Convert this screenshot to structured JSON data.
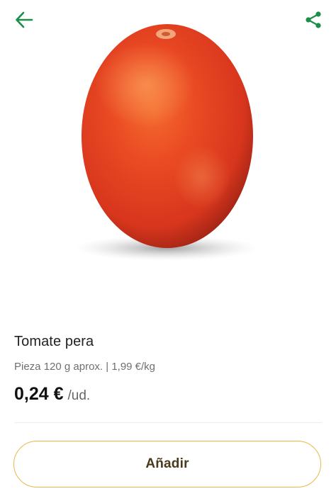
{
  "header": {
    "back_icon": "arrow-left-icon",
    "share_icon": "share-icon",
    "accent_color": "#1a8f4a"
  },
  "product": {
    "name": "Tomate pera",
    "meta": "Pieza 120 g aprox. | 1,99 €/kg",
    "price": "0,24 €",
    "price_unit": "/ud."
  },
  "actions": {
    "add_label": "Añadir",
    "add_border_color": "#e8b84a"
  }
}
